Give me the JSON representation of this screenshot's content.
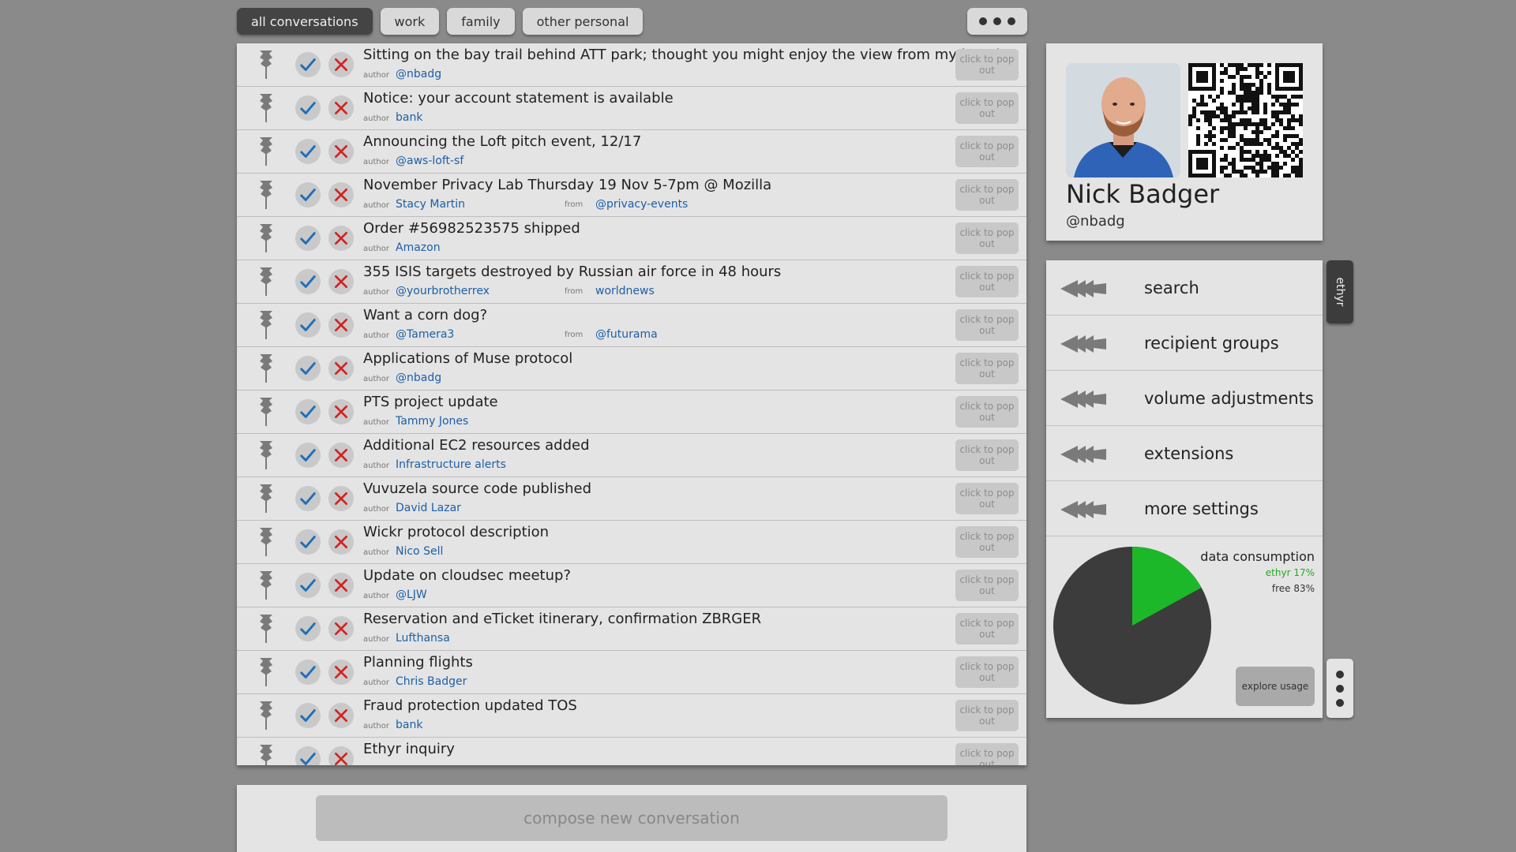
{
  "tabs": [
    {
      "label": "all conversations",
      "active": true
    },
    {
      "label": "work",
      "active": false
    },
    {
      "label": "family",
      "active": false
    },
    {
      "label": "other personal",
      "active": false
    }
  ],
  "row_labels": {
    "author": "author",
    "from": "from",
    "popout": "click to pop out"
  },
  "conversations": [
    {
      "subject": "Sitting on the bay trail behind ATT park; thought you might enjoy the view from my bench",
      "author": "@nbadg",
      "from": ""
    },
    {
      "subject": "Notice: your account statement is available",
      "author": "bank",
      "from": ""
    },
    {
      "subject": "Announcing the Loft pitch event, 12/17",
      "author": "@aws-loft-sf",
      "from": ""
    },
    {
      "subject": "November Privacy Lab Thursday 19 Nov 5-7pm @ Mozilla",
      "author": "Stacy Martin",
      "from": "@privacy-events"
    },
    {
      "subject": "Order #56982523575 shipped",
      "author": "Amazon",
      "from": ""
    },
    {
      "subject": "355 ISIS targets destroyed by Russian air force in 48 hours",
      "author": "@yourbrotherrex",
      "from": "worldnews"
    },
    {
      "subject": "Want a corn dog?",
      "author": "@Tamera3",
      "from": "@futurama"
    },
    {
      "subject": "Applications of Muse protocol",
      "author": "@nbadg",
      "from": ""
    },
    {
      "subject": "PTS project update",
      "author": "Tammy Jones",
      "from": ""
    },
    {
      "subject": "Additional EC2 resources added",
      "author": "Infrastructure alerts",
      "from": ""
    },
    {
      "subject": "Vuvuzela source code published",
      "author": "David Lazar",
      "from": ""
    },
    {
      "subject": "Wickr protocol description",
      "author": "Nico Sell",
      "from": ""
    },
    {
      "subject": "Update on cloudsec meetup?",
      "author": "@LJW",
      "from": ""
    },
    {
      "subject": "Reservation and eTicket itinerary, confirmation ZBRGER",
      "author": "Lufthansa",
      "from": ""
    },
    {
      "subject": "Planning flights",
      "author": "Chris Badger",
      "from": ""
    },
    {
      "subject": "Fraud protection updated TOS",
      "author": "bank",
      "from": ""
    },
    {
      "subject": "Ethyr inquiry",
      "author": "",
      "from": ""
    }
  ],
  "compose": {
    "label": "compose new conversation"
  },
  "profile": {
    "name": "Nick Badger",
    "handle": "@nbadg"
  },
  "menu": [
    {
      "label": "search"
    },
    {
      "label": "recipient groups"
    },
    {
      "label": "volume adjustments"
    },
    {
      "label": "extensions"
    },
    {
      "label": "more settings"
    }
  ],
  "usage": {
    "title": "data consumption",
    "ethyr_label": "ethyr 17%",
    "free_label": "free 83%",
    "ethyr_fraction": 0.17,
    "explore_label": "explore usage",
    "colors": {
      "ethyr": "#1db829",
      "free": "#3c3c3c"
    }
  },
  "side_tab": {
    "label": "ethyr"
  }
}
